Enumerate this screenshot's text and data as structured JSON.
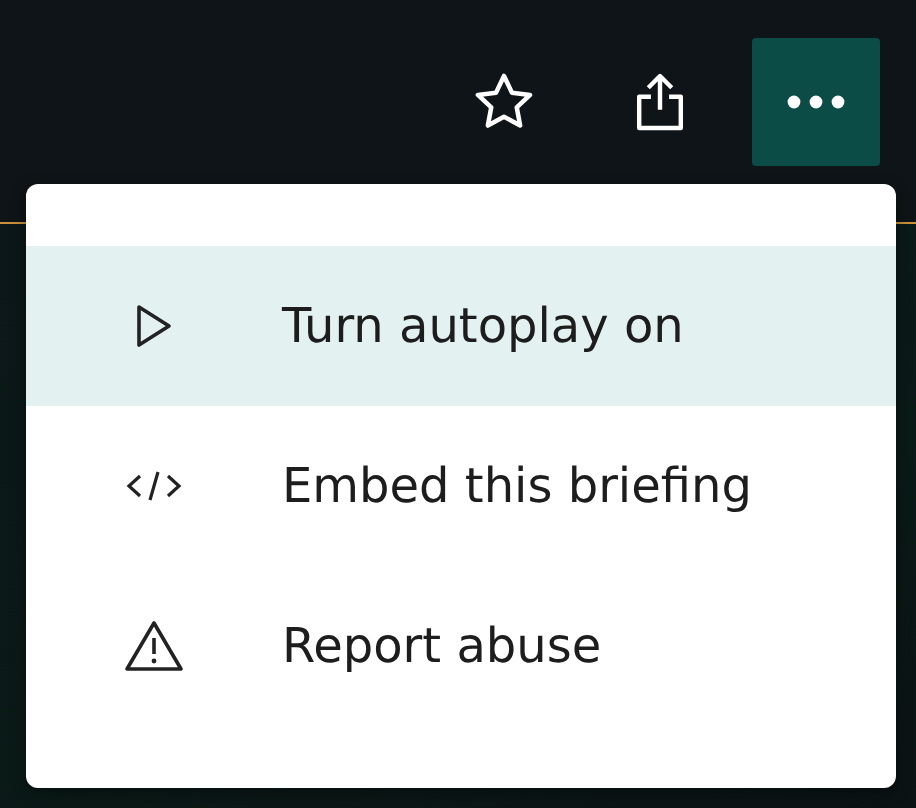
{
  "toolbar": {
    "buttons": [
      {
        "kind": "star",
        "selected": false
      },
      {
        "kind": "share",
        "selected": false
      },
      {
        "kind": "more",
        "selected": true
      }
    ]
  },
  "menu": {
    "items": [
      {
        "kind": "play",
        "label": "Turn autoplay on",
        "selected": true
      },
      {
        "kind": "embed",
        "label": "Embed this briefing",
        "selected": false
      },
      {
        "kind": "warning",
        "label": "Report abuse",
        "selected": false
      }
    ]
  }
}
